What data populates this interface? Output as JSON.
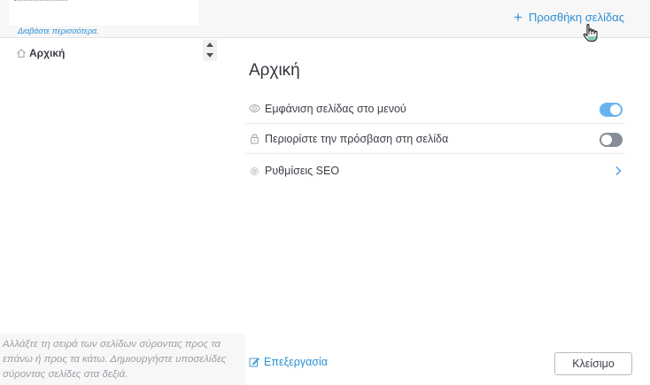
{
  "header": {
    "read_more_label": "Διαβάστε περισσότερα.",
    "add_page_label": "Προσθήκη σελίδας"
  },
  "sidebar": {
    "pages": [
      {
        "label": "Αρχική",
        "icon": "home-icon"
      }
    ],
    "hint_text": "Αλλάξτε τη σειρά των σελίδων σύροντας προς τα επάνω ή προς τα κάτω. Δημιουργήστε υποσελίδες σύροντας σελίδες στα δεξιά."
  },
  "main": {
    "title": "Αρχική",
    "settings": [
      {
        "label": "Εμφάνιση σελίδας στο μενού",
        "icon": "eye-icon",
        "control": "toggle",
        "enabled": true
      },
      {
        "label": "Περιορίστε την πρόσβαση στη σελίδα",
        "icon": "lock-icon",
        "control": "toggle",
        "enabled": false
      },
      {
        "label": "Ρυθμίσεις SEO",
        "icon": "gear-icon",
        "control": "chevron"
      }
    ],
    "edit_label": "Επεξεργασία",
    "close_label": "Κλείσιμο"
  },
  "colors": {
    "accent": "#2d8fd5",
    "toggle_on": "#3899ec",
    "toggle_off": "#868d96",
    "panel_bg": "#f7f7f8"
  }
}
